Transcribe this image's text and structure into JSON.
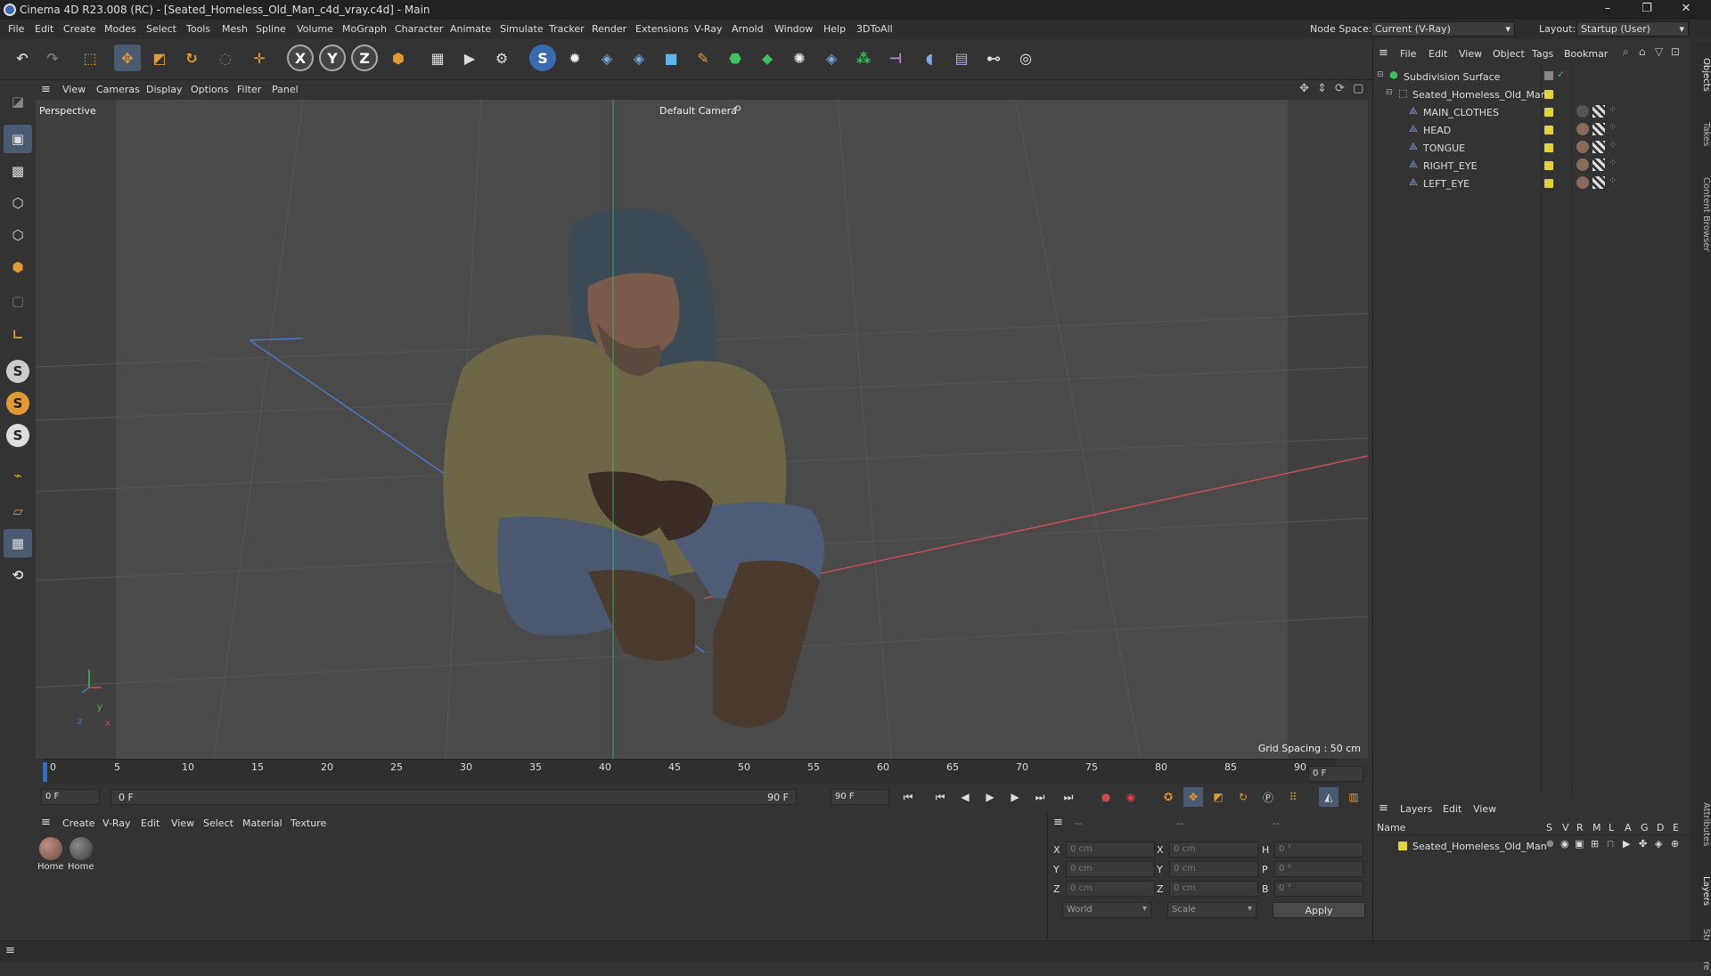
{
  "window": {
    "title": "Cinema 4D R23.008 (RC) - [Seated_Homeless_Old_Man_c4d_vray.c4d] - Main",
    "minimize": "–",
    "maximize": "❐",
    "close": "✕"
  },
  "menubar": {
    "items": [
      "File",
      "Edit",
      "Create",
      "Modes",
      "Select",
      "Tools",
      "Mesh",
      "Spline",
      "Volume",
      "MoGraph",
      "Character",
      "Animate",
      "Simulate",
      "Tracker",
      "Render",
      "Extensions",
      "V-Ray",
      "Arnold",
      "Window",
      "Help",
      "3DToAll"
    ],
    "node_space_label": "Node Space:",
    "node_space_value": "Current (V-Ray)",
    "layout_label": "Layout:",
    "layout_value": "Startup (User)"
  },
  "toolbar": {
    "axis_x": "X",
    "axis_y": "Y",
    "axis_z": "Z"
  },
  "viewport": {
    "menu": [
      "View",
      "Cameras",
      "Display",
      "Options",
      "Filter",
      "Panel"
    ],
    "view_label": "Perspective",
    "camera_label": "Default Camera",
    "grid_spacing": "Grid Spacing : 50 cm",
    "axis_y": "y",
    "axis_z": "z",
    "axis_x": "x"
  },
  "timeline": {
    "ticks": [
      "0",
      "5",
      "10",
      "15",
      "20",
      "25",
      "30",
      "35",
      "40",
      "45",
      "50",
      "55",
      "60",
      "65",
      "70",
      "75",
      "80",
      "85",
      "90"
    ],
    "current_frame": "0 F",
    "start_frame": "0 F",
    "range_start": "0 F",
    "range_end": "90 F",
    "end_frame": "90 F"
  },
  "material_panel": {
    "menu": [
      "Create",
      "V-Ray",
      "Edit",
      "View",
      "Select",
      "Material",
      "Texture"
    ],
    "materials": [
      "Home",
      "Home"
    ]
  },
  "coord_panel": {
    "header_a": "--",
    "header_b": "--",
    "header_c": "--",
    "rows": [
      {
        "a_label": "X",
        "a_value": "0 cm",
        "b_label": "X",
        "b_value": "0 cm",
        "c_label": "H",
        "c_value": "0 °"
      },
      {
        "a_label": "Y",
        "a_value": "0 cm",
        "b_label": "Y",
        "b_value": "0 cm",
        "c_label": "P",
        "c_value": "0 °"
      },
      {
        "a_label": "Z",
        "a_value": "0 cm",
        "b_label": "Z",
        "b_value": "0 cm",
        "c_label": "B",
        "c_value": "0 °"
      }
    ],
    "mode_select": "World",
    "scale_select": "Scale",
    "apply": "Apply"
  },
  "object_panel": {
    "menu": [
      "File",
      "Edit",
      "View",
      "Object",
      "Tags",
      "Bookmar"
    ],
    "objects": [
      {
        "name": "Subdivision Surface",
        "indent": 0
      },
      {
        "name": "Seated_Homeless_Old_Man",
        "indent": 1
      },
      {
        "name": "MAIN_CLOTHES",
        "indent": 2
      },
      {
        "name": "HEAD",
        "indent": 2
      },
      {
        "name": "TONGUE",
        "indent": 2
      },
      {
        "name": "RIGHT_EYE",
        "indent": 2
      },
      {
        "name": "LEFT_EYE",
        "indent": 2
      }
    ]
  },
  "layer_panel": {
    "menu": [
      "Layers",
      "Edit",
      "View"
    ],
    "name_header": "Name",
    "col_headers": [
      "S",
      "V",
      "R",
      "M",
      "L",
      "A",
      "G",
      "D",
      "E"
    ],
    "layer_name": "Seated_Homeless_Old_Man"
  },
  "right_tabs": [
    "Objects",
    "Takes",
    "Content Browser",
    "Attributes",
    "Layers",
    "Structure"
  ],
  "colors": {
    "accent_blue": "#3a6bb0",
    "layer_yellow": "#e5d23a",
    "axis_red": "#c85050",
    "axis_green": "#3fbf5f",
    "axis_blue": "#4a78c8"
  }
}
